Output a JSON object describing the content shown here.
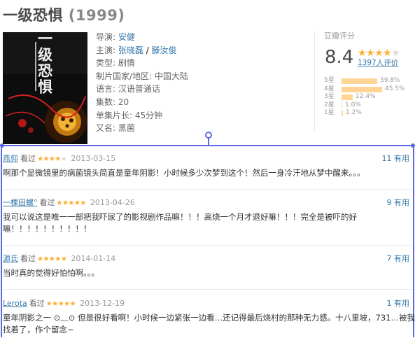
{
  "movie": {
    "title": "一级恐惧",
    "year": "(1999)",
    "poster_text": "一级恐惧"
  },
  "info": {
    "director_label": "导演: ",
    "director": "安健",
    "cast_label": "主演: ",
    "cast_1": "张晓磊",
    "cast_sep": " / ",
    "cast_2": "滕汝俊",
    "genre": "类型: 剧情",
    "country": "制片国家/地区: 中国大陆",
    "language": "语言: 汉语普通话",
    "episodes": "集数: 20",
    "runtime": "单集片长: 45分钟",
    "aka": "又名: 黑菌"
  },
  "rating": {
    "label": "豆瓣评分",
    "score": "8.4",
    "stars": "★★★★",
    "stars_off": "★",
    "count": "1397人评价",
    "distribution": [
      {
        "label": "5星",
        "percent": 39.8,
        "text": "39.8%"
      },
      {
        "label": "4星",
        "percent": 45.5,
        "text": "45.5%"
      },
      {
        "label": "3星",
        "percent": 12.4,
        "text": "12.4%"
      },
      {
        "label": "2星",
        "percent": 1.0,
        "text": "1.0%"
      },
      {
        "label": "1星",
        "percent": 1.2,
        "text": "1.2%"
      }
    ]
  },
  "comments": [
    {
      "user": "燕仰",
      "seen": "看过",
      "stars": "★★★★",
      "stars_off": "★",
      "date": "2013-03-15",
      "useful_count": "11",
      "useful_label": "有用",
      "text": "啊那个显微镜里的病菌镜头简直是童年阴影！小时候多少次梦到这个！然后一身冷汗地从梦中醒来。。。"
    },
    {
      "user": "一棵田螺°",
      "seen": "看过",
      "stars": "★★★★★",
      "stars_off": "",
      "date": "2013-04-26",
      "useful_count": "9",
      "useful_label": "有用",
      "text": "我可以说这是唯一一部把我吓尿了的影视剧作品嘛！！！高烧一个月才退好嘛！！！完全是被吓的好",
      "text_2": "嘛！！！！！！！！！！"
    },
    {
      "user": "源氏",
      "seen": "看过",
      "stars": "★★★★★",
      "stars_off": "",
      "date": "2014-01-14",
      "useful_count": "7",
      "useful_label": "有用",
      "text": "当时真的觉得好怕怕啊。。。"
    },
    {
      "user": "Lerota",
      "seen": "看过",
      "stars": "★★★★★",
      "stars_off": "",
      "date": "2013-12-19",
      "useful_count": "1",
      "useful_label": "有用",
      "text": "童年阴影之一 ⊙﹏⊙ 但是很好看啊！小时候一边紧张一边看…还记得最后烧村的那种无力感。十八里坡，731…被我",
      "text_2": "找着了，作个留念~"
    }
  ],
  "colors": {
    "link": "#3377aa",
    "star": "#ffac2d",
    "bar": "#ffd596",
    "selection": "#5a6ae6"
  }
}
